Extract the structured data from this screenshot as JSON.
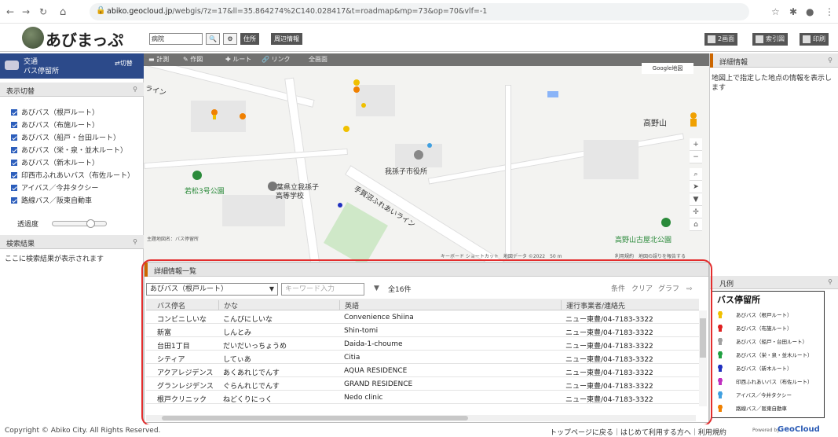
{
  "browser": {
    "url_host": "abiko.geocloud.jp",
    "url_path": "/webgis/?z=17&ll=35.864274%2C140.028417&t=roadmap&mp=73&op=70&vlf=-1"
  },
  "header": {
    "logo_text": "あびまっぷ",
    "search_value": "病院",
    "address_btn": "住所",
    "around_btn": "周辺情報",
    "two_screen": "2画面",
    "index_map": "索引図",
    "print": "印刷"
  },
  "left": {
    "layer_title1": "交通",
    "layer_title2": "バス停留所",
    "switch_label": "切替",
    "display_switch": "表示切替",
    "layers": [
      "あびバス（根戸ルート）",
      "あびバス（布施ルート）",
      "あびバス（船戸・台田ルート）",
      "あびバス（栄・泉・並木ルート）",
      "あびバス（新木ルート）",
      "印西市ふれあいバス（布佐ルート）",
      "アイバス／今井タクシー",
      "路線バス／阪東自動車"
    ],
    "opacity_label": "透過度",
    "opacity_value": 0.7,
    "search_results": "検索結果",
    "search_results_msg": "ここに検索結果が表示されます"
  },
  "map": {
    "tools": [
      "計測",
      "作図",
      "ルート",
      "リンク",
      "全画面"
    ],
    "google_map_btn": "Google地図",
    "labels": {
      "city_hall": "我孫子市役所",
      "park1": "若松3号公園",
      "school1": "千葉県立我孫子",
      "school2": "高等学校",
      "road": "手賀沼ふれあいライン",
      "mountain": "高野山",
      "park2": "高野山古屋北公園",
      "partial_road": "ライン"
    },
    "theme_caption": "主題地図名：バス停留所",
    "attribution": "キーボード ショートカット　地図データ ©2022　50 m",
    "terms": "利用規約　地図の誤りを報告する"
  },
  "right": {
    "detail_title": "詳細情報",
    "detail_text": "地図上で指定した地点の情報を表示します",
    "legend_title": "凡例",
    "legend_header": "バス停留所",
    "legend_items": [
      {
        "label": "あびバス（根戸ルート）",
        "color": "#f0c000"
      },
      {
        "label": "あびバス（布施ルート）",
        "color": "#e02020"
      },
      {
        "label": "あびバス（船戸・台田ルート）",
        "color": "#a0a0a0"
      },
      {
        "label": "あびバス（栄・泉・並木ルート）",
        "color": "#20a040"
      },
      {
        "label": "あびバス（新木ルート）",
        "color": "#2030c0"
      },
      {
        "label": "印西ふれあいバス（布佐ルート）",
        "color": "#c030c0"
      },
      {
        "label": "アイバス／今井タクシー",
        "color": "#40a0e0"
      },
      {
        "label": "路線バス／阪東自動車",
        "color": "#f08000"
      }
    ]
  },
  "list": {
    "title": "詳細情報一覧",
    "selected_route": "あびバス（根戸ルート）",
    "keyword_placeholder": "キーワード入力",
    "count": "全16件",
    "buttons": [
      "条件",
      "クリア",
      "グラフ"
    ],
    "columns": [
      "バス停名",
      "かな",
      "英語",
      "運行事業者/連絡先"
    ],
    "rows": [
      [
        "コンビニしいな",
        "こんびにしいな",
        "Convenience Shiina",
        "ニュー東豊/04-7183-3322"
      ],
      [
        "新富",
        "しんとみ",
        "Shin-tomi",
        "ニュー東豊/04-7183-3322"
      ],
      [
        "台田1丁目",
        "だいだいっちょうめ",
        "Daida-1-choume",
        "ニュー東豊/04-7183-3322"
      ],
      [
        "シティア",
        "してぃあ",
        "Citia",
        "ニュー東豊/04-7183-3322"
      ],
      [
        "アクアレジデンス",
        "あくあれじでんす",
        "AQUA RESIDENCE",
        "ニュー東豊/04-7183-3322"
      ],
      [
        "グランレジデンス",
        "ぐらんれじでんす",
        "GRAND RESIDENCE",
        "ニュー東豊/04-7183-3322"
      ],
      [
        "根戸クリニック",
        "ねどくりにっく",
        "Nedo clinic",
        "ニュー東豊/04-7183-3322"
      ]
    ]
  },
  "footer": {
    "copyright": "Copyright © Abiko City. All Rights Reserved.",
    "links": "トップページに戻る｜はじめて利用する方へ｜利用規約",
    "powered": "Powered by",
    "brand": "GeoCloud"
  }
}
